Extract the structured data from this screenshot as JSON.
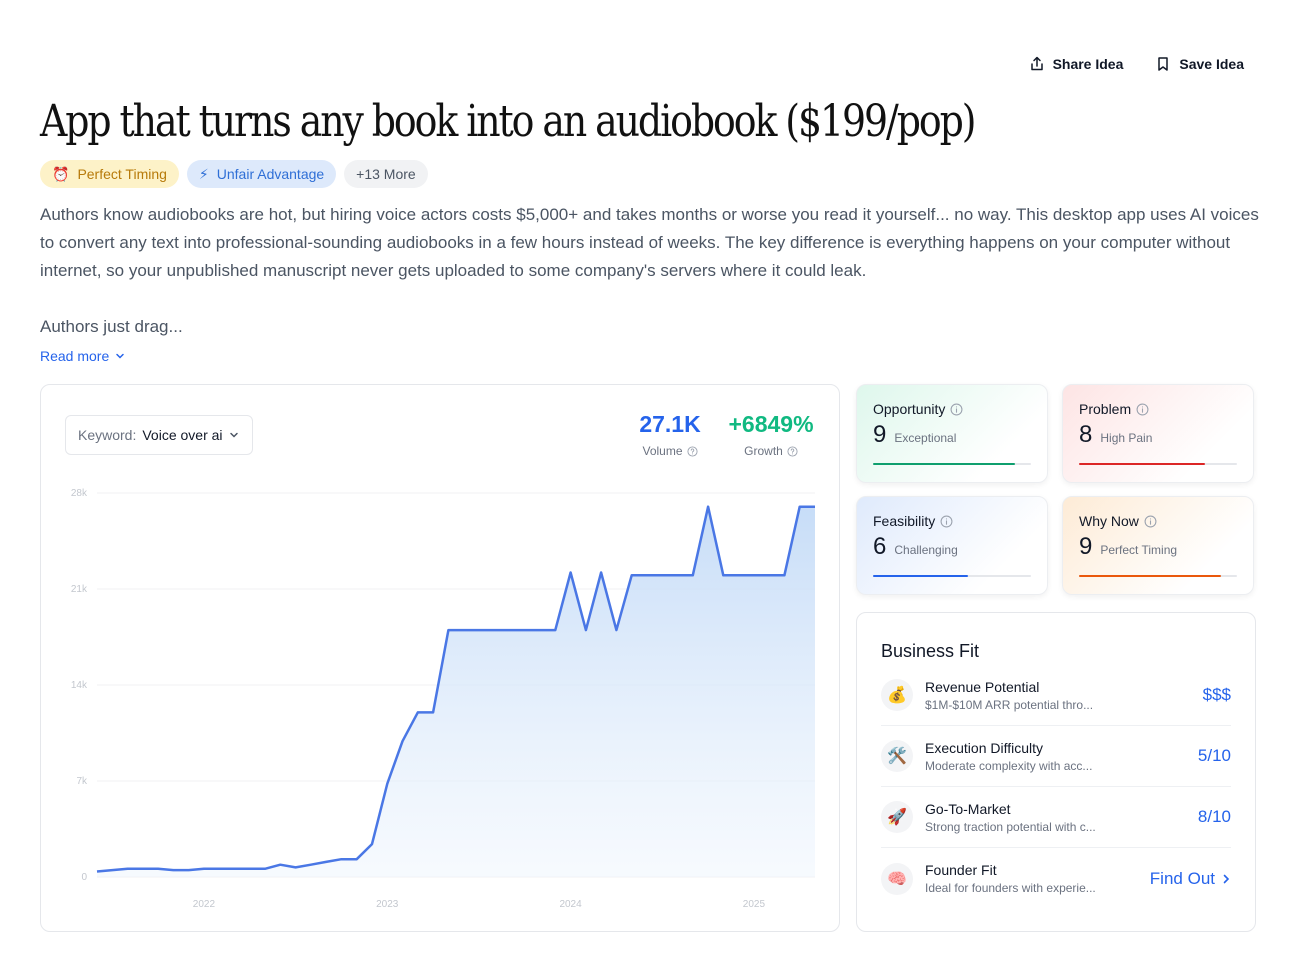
{
  "actions": {
    "share_label": "Share Idea",
    "save_label": "Save Idea"
  },
  "title": "App that turns any book into an audiobook ($199/pop)",
  "tags": [
    {
      "icon": "alarm-clock-icon",
      "label": "Perfect Timing"
    },
    {
      "icon": "lightning-icon",
      "label": "Unfair Advantage"
    },
    {
      "label": "+13 More"
    }
  ],
  "description": "Authors know audiobooks are hot, but hiring voice actors costs $5,000+ and takes months or worse you read it yourself... no way.  This desktop app uses AI voices to convert any text into professional-sounding audiobooks in a few hours instead of weeks. The key difference is everything happens on your computer without internet, so your unpublished manuscript never gets uploaded to some company's servers where it could leak.",
  "description_more": "Authors just drag...",
  "read_more": "Read more",
  "keyword": {
    "label": "Keyword:",
    "value": "Voice over ai"
  },
  "metrics": {
    "volume": {
      "value": "27.1K",
      "label": "Volume"
    },
    "growth": {
      "value": "+6849%",
      "label": "Growth"
    }
  },
  "chart_data": {
    "type": "area",
    "y_ticks": [
      "28k",
      "21k",
      "14k",
      "7k",
      "0"
    ],
    "x_ticks": [
      "2022",
      "2023",
      "2024",
      "2025"
    ],
    "ylim": [
      0,
      28000
    ],
    "color": "#4a77e5",
    "x": [
      "2021-06",
      "2021-07",
      "2021-08",
      "2021-09",
      "2021-10",
      "2021-11",
      "2021-12",
      "2022-01",
      "2022-02",
      "2022-03",
      "2022-04",
      "2022-05",
      "2022-06",
      "2022-07",
      "2022-08",
      "2022-09",
      "2022-10",
      "2022-11",
      "2022-12",
      "2023-01",
      "2023-02",
      "2023-03",
      "2023-04",
      "2023-05",
      "2023-06",
      "2023-07",
      "2023-08",
      "2023-09",
      "2023-10",
      "2023-11",
      "2023-12",
      "2024-01",
      "2024-02",
      "2024-03",
      "2024-04",
      "2024-05",
      "2024-06",
      "2024-07",
      "2024-08",
      "2024-09",
      "2024-10",
      "2024-11",
      "2024-12",
      "2025-01",
      "2025-02",
      "2025-03",
      "2025-04",
      "2025-05"
    ],
    "values": [
      400,
      500,
      600,
      600,
      600,
      500,
      500,
      600,
      600,
      600,
      600,
      600,
      900,
      700,
      900,
      1100,
      1300,
      1300,
      2400,
      6800,
      9900,
      12000,
      12000,
      18000,
      18000,
      18000,
      18000,
      18000,
      18000,
      18000,
      18000,
      22200,
      18000,
      22200,
      18000,
      22000,
      22000,
      22000,
      22000,
      22000,
      27000,
      22000,
      22000,
      22000,
      22000,
      22000,
      27000,
      27000
    ]
  },
  "scores": [
    {
      "title": "Opportunity",
      "num": "9",
      "text": "Exceptional",
      "color": "#0f9f6e",
      "fill": 0.9
    },
    {
      "title": "Problem",
      "num": "8",
      "text": "High Pain",
      "color": "#dc2626",
      "fill": 0.8
    },
    {
      "title": "Feasibility",
      "num": "6",
      "text": "Challenging",
      "color": "#2563eb",
      "fill": 0.6
    },
    {
      "title": "Why Now",
      "num": "9",
      "text": "Perfect Timing",
      "color": "#ea580c",
      "fill": 0.9
    }
  ],
  "business_fit": {
    "title": "Business Fit",
    "rows": [
      {
        "icon": "money-bag-icon",
        "name": "Revenue Potential",
        "sub": "$1M-$10M ARR potential thro...",
        "value": "$$$"
      },
      {
        "icon": "tools-icon",
        "name": "Execution Difficulty",
        "sub": "Moderate complexity with acc...",
        "value": "5/10"
      },
      {
        "icon": "rocket-icon",
        "name": "Go-To-Market",
        "sub": "Strong traction potential with c...",
        "value": "8/10"
      },
      {
        "icon": "brain-icon",
        "name": "Founder Fit",
        "sub": "Ideal for founders with experie...",
        "value": "Find Out"
      }
    ]
  }
}
